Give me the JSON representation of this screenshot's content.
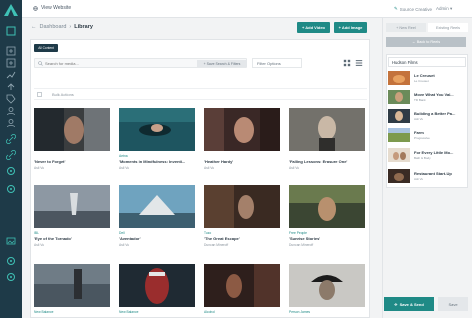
{
  "topbar": {
    "view_website": "View Website",
    "source_creative": "Source Creative",
    "admin": "Admin"
  },
  "header": {
    "breadcrumb_parent": "Dashboard",
    "breadcrumb_current": "Library",
    "add_video": "+ Add Video",
    "add_image": "+ Add Image"
  },
  "filters": {
    "all_content": "All Content",
    "search_placeholder": "Search for media...",
    "save_search": "+ Save Search & Filters",
    "filter_options": "Filter Options",
    "bulk_actions": "Bulk Actions"
  },
  "cards": [
    {
      "cat": "",
      "title": "'Never to Forget'",
      "author": "Asli Vu"
    },
    {
      "cat": "Aetna",
      "title": "'Moments in Mindfulness: Inventi...",
      "author": "Asli Vu"
    },
    {
      "cat": "",
      "title": "'Heather Hardy'",
      "author": "Asli Vu"
    },
    {
      "cat": "",
      "title": "'Falling Lessons: Erasure One'",
      "author": "Asli Vu"
    },
    {
      "cat": "IBL",
      "title": "'Eye of the Tornado'",
      "author": "Asli Vu"
    },
    {
      "cat": "Dell",
      "title": "'Aventador'",
      "author": "Asli Vu"
    },
    {
      "cat": "Tuzo",
      "title": "'The Great Escape'",
      "author": "Duncan Mineroff"
    },
    {
      "cat": "Free People",
      "title": "'Sunrise Stories'",
      "author": "Duncan Mineroff"
    },
    {
      "cat": "New Balance",
      "title": "",
      "author": ""
    },
    {
      "cat": "New Balance",
      "title": "",
      "author": ""
    },
    {
      "cat": "Alcohol",
      "title": "",
      "author": ""
    },
    {
      "cat": "Person James",
      "title": "",
      "author": ""
    }
  ],
  "right": {
    "new_reel": "+ New Reel",
    "existing_reels": "Existing Reels",
    "back_to_reels": "← Back to Reels",
    "reel_name": "Hudson Films",
    "reels": [
      {
        "name": "Le Creuset",
        "sub": "Le Creuset"
      },
      {
        "name": "Move What You Val...",
        "sub": "TD Bank"
      },
      {
        "name": "Building a Better Pa...",
        "sub": "Asli Vu"
      },
      {
        "name": "Farm",
        "sub": "Progressive"
      },
      {
        "name": "For Every Little Mo...",
        "sub": "Bath & Body"
      },
      {
        "name": "Restaurant Start-Up",
        "sub": "Asli Vu"
      }
    ],
    "save_send": "Save & Send",
    "save": "Save"
  },
  "colors": {
    "accent": "#1f8a86",
    "rail": "#1e3a48"
  }
}
